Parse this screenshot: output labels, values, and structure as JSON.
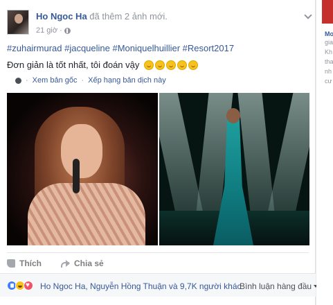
{
  "post": {
    "author": "Ho Ngoc Ha",
    "action": "đã thêm 2 ảnh mới.",
    "timestamp": "21 giờ",
    "privacy_icon": "globe-icon",
    "hashtags": "#zuhairmurad #jacqueline #Moniquelhuillier #Resort2017",
    "caption": "Đơn giản là tốt nhất, tôi đoán vậy",
    "caption_emoji_count": 5,
    "see_original": "Xem bản gốc",
    "rate_translation": "Xếp hạng bản dịch này"
  },
  "actions": {
    "like": "Thích",
    "share": "Chia sẻ"
  },
  "reactions": {
    "icons": [
      "like-icon",
      "haha-icon",
      "love-icon"
    ],
    "summary": "Ho Ngoc Ha, Nguyễn Hồng Thuận và 9,7K người khác",
    "sort_label": "Bình luận hàng đầu"
  },
  "right_column": {
    "lines": [
      "Mo",
      "gia",
      "Kh",
      "tha",
      "nh",
      "cư"
    ]
  },
  "colors": {
    "link": "#365899",
    "meta": "#90949c",
    "background": "#e9ebee"
  }
}
